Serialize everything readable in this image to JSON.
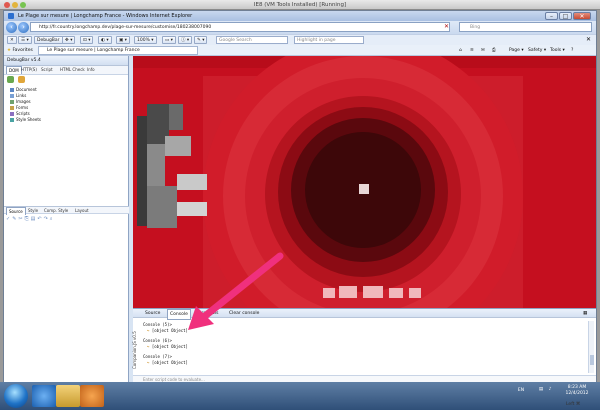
{
  "mac_window": {
    "title": "IE8 (VM Tools Installed) [Running]"
  },
  "ie": {
    "title": "Le Plage sur mesure | Longchamp France - Windows Internet Explorer",
    "address": "http://fr.country.longchamp.dev/plage-sur-mesure/customise/180238007090",
    "search_placeholder": "Bing",
    "toolbar": {
      "debugbar_label": "DebugBar",
      "zoom": "100%",
      "google_search_placeholder": "Google Search",
      "highlight_placeholder": "Highlight in page"
    },
    "favorites_label": "Favorites",
    "page_tab": "Le Plage sur mesure | Longchamp France",
    "command_bar": [
      "Page ▾",
      "Safety ▾",
      "Tools ▾",
      "?"
    ]
  },
  "debugbar": {
    "title": "DebugBar v5.4",
    "tabs": [
      "DOM",
      "HTTP(S)",
      "Script",
      "HTML Check",
      "Info"
    ],
    "tree": [
      "Document",
      "Links",
      "Images",
      "Forms",
      "Scripts",
      "Style Sheets"
    ],
    "source_tabs": [
      "Source",
      "Style",
      "Comp. Style",
      "Layout"
    ]
  },
  "console": {
    "tabs": [
      "Source",
      "Console",
      "More tools",
      "Clear console"
    ],
    "vertical_label": "Companion.JS v0.5",
    "lines": [
      {
        "cmd": "Console (5)>",
        "result": "[object Object]"
      },
      {
        "cmd": "Console (6)>",
        "result": "[object Object]"
      },
      {
        "cmd": "Console (7)>",
        "result": "[object Object]"
      }
    ],
    "eval_placeholder": "Enter script code to evaluate..."
  },
  "status": {
    "left": "Done",
    "zone": "Internet | Protected Mode: Off",
    "zoom": "100%"
  },
  "taskbar": {
    "language": "EN",
    "time": "8:23 AM",
    "date": "12/4/2012",
    "mode": "Left ⌘"
  },
  "colors": {
    "page_red": "#c50f1f",
    "dark_center": "#3d0709",
    "arrow": "#f0307d"
  }
}
